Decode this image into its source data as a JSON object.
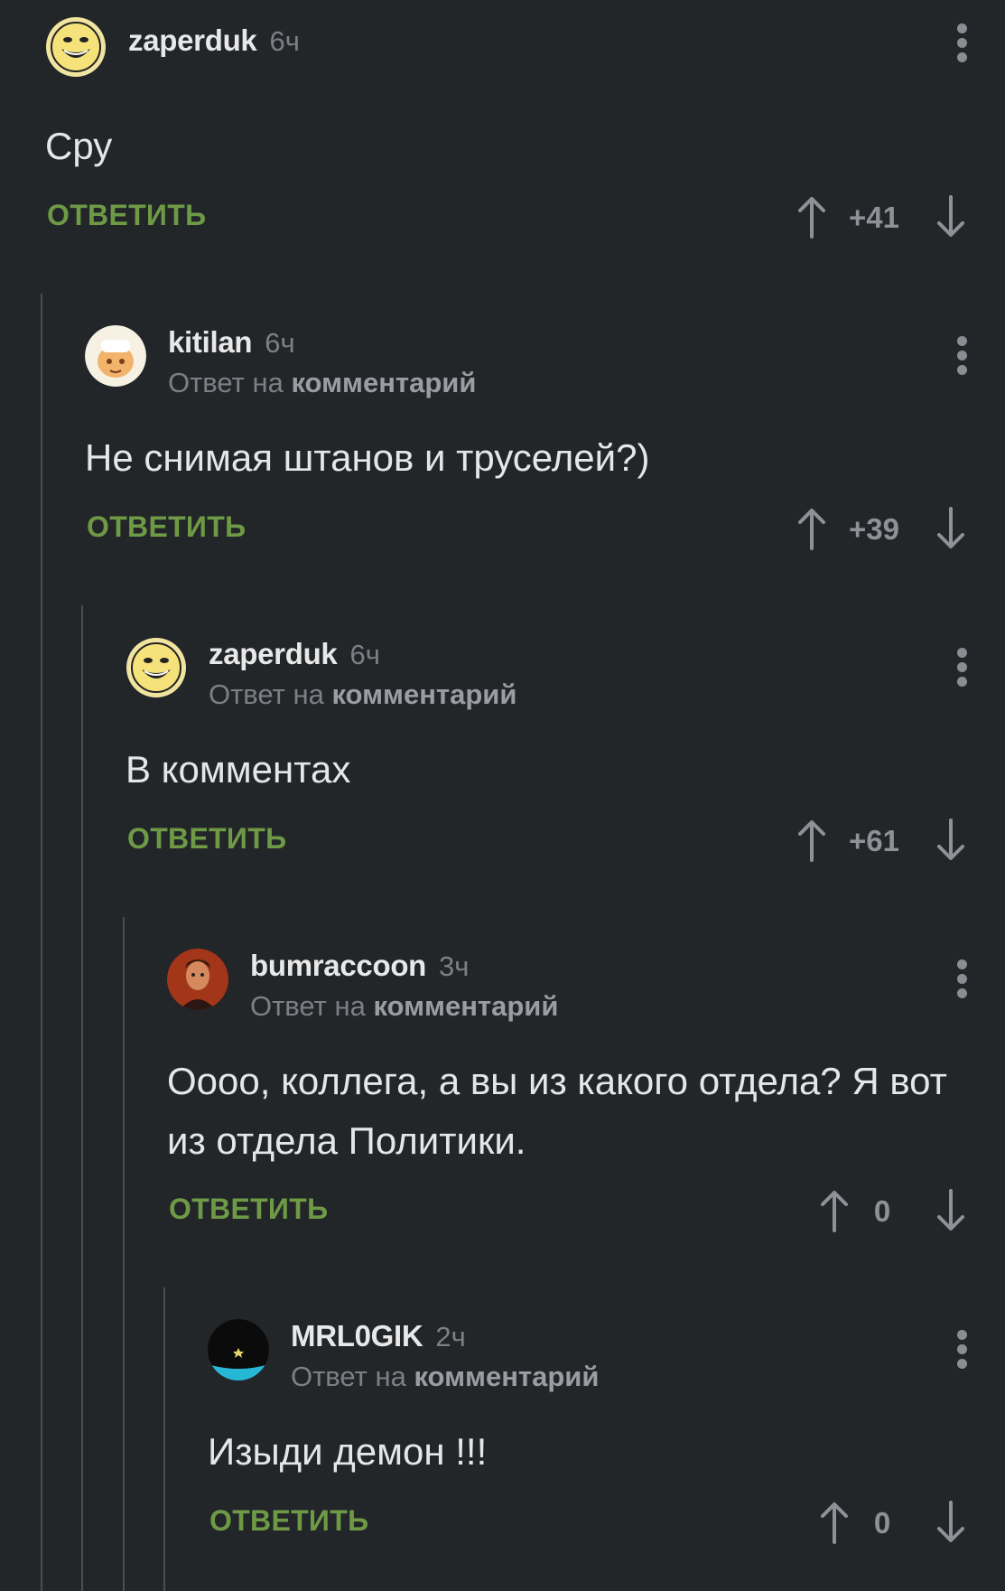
{
  "thread": {
    "reply_label": "ОТВЕТИТЬ",
    "reply_to_prefix": "Ответ на",
    "reply_to_target": "комментарий"
  },
  "comments": [
    {
      "username": "zaperduk",
      "time": "6ч",
      "text": "Сру",
      "score": "+41",
      "avatar": "troll-face-avatar"
    },
    {
      "username": "kitilan",
      "time": "6ч",
      "text": "Не снимая штанов и труселей?)",
      "score": "+39",
      "avatar": "cartoon-avatar"
    },
    {
      "username": "zaperduk",
      "time": "6ч",
      "text": "В комментах",
      "score": "+61",
      "avatar": "troll-face-avatar"
    },
    {
      "username": "bumraccoon",
      "time": "3ч",
      "text": "Оооо, коллега, а вы из какого отдела? Я вот из отдела Политики.",
      "score": "0",
      "avatar": "photo-avatar"
    },
    {
      "username": "MRL0GIK",
      "time": "2ч",
      "text": "Изыди демон !!!",
      "score": "0",
      "avatar": "dark-avatar"
    }
  ],
  "colors": {
    "background": "#232629",
    "reply_green": "#6e9a46",
    "meta_gray": "#7c8085",
    "thread_line": "#4a4e52"
  }
}
